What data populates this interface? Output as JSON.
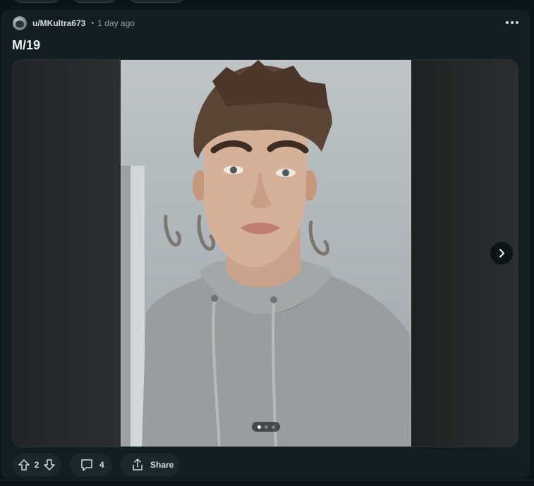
{
  "post": {
    "author": "u/MKultra673",
    "separator": "•",
    "time": "1 day ago",
    "title": "M/19",
    "menu_icon": "more-horizontal-icon"
  },
  "media": {
    "gallery_position": 1,
    "gallery_count": 3,
    "next_icon": "chevron-right-icon",
    "image_description_icon": "photo"
  },
  "actions": {
    "upvote_icon": "upvote-icon",
    "score": "2",
    "downvote_icon": "downvote-icon",
    "comment_icon": "comment-icon",
    "comments": "4",
    "share_icon": "share-icon",
    "share_label": "Share"
  },
  "colors": {
    "background": "#0b1416",
    "card": "#131e22",
    "pill": "#1a282d",
    "text": "#d7dadc",
    "muted": "#8ba2ad"
  }
}
